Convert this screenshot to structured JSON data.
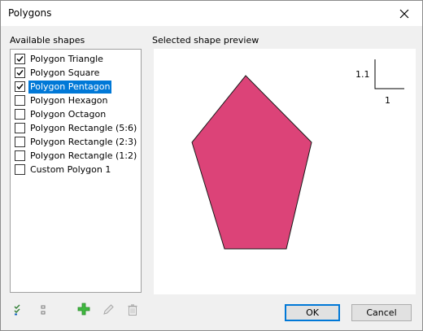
{
  "window": {
    "title": "Polygons"
  },
  "available": {
    "label": "Available shapes",
    "items": [
      {
        "label": "Polygon Triangle",
        "checked": true
      },
      {
        "label": "Polygon Square",
        "checked": true
      },
      {
        "label": "Polygon Pentagon",
        "checked": true,
        "selected": true
      },
      {
        "label": "Polygon Hexagon",
        "checked": false
      },
      {
        "label": "Polygon Octagon",
        "checked": false
      },
      {
        "label": "Polygon Rectangle (5:6)",
        "checked": false
      },
      {
        "label": "Polygon Rectangle (2:3)",
        "checked": false
      },
      {
        "label": "Polygon Rectangle (1:2)",
        "checked": false
      },
      {
        "label": "Custom Polygon 1",
        "checked": false
      }
    ]
  },
  "preview": {
    "label": "Selected shape preview",
    "scale_y": "1.1",
    "scale_x": "1",
    "fill_color": "#dc4378"
  },
  "buttons": {
    "ok": "OK",
    "cancel": "Cancel"
  },
  "colors": {
    "selection": "#0078d7",
    "add_icon": "#3fb83f"
  }
}
